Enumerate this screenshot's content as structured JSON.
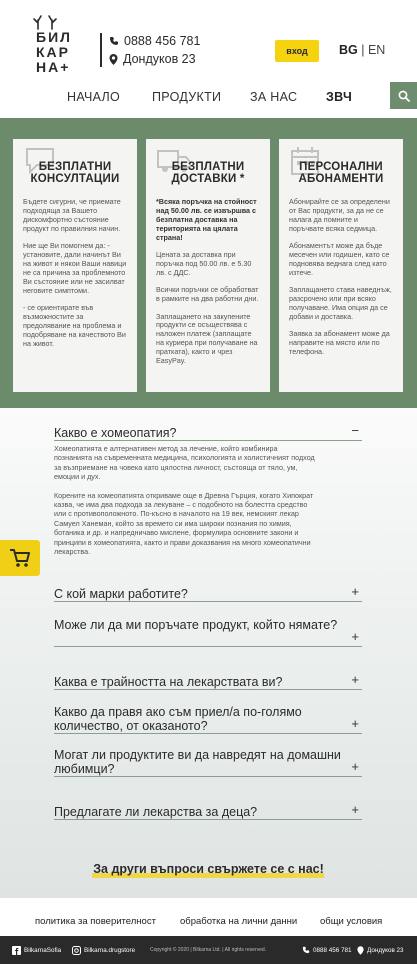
{
  "header": {
    "logo_text": [
      "БИЛ",
      "КАР",
      "НА+"
    ],
    "phone": "0888 456 781",
    "address": "Дондуков 23",
    "login_label": "вход",
    "lang_bg": "BG",
    "lang_sep": "|",
    "lang_en": "EN"
  },
  "nav": {
    "items": [
      "НАЧАЛО",
      "ПРОДУКТИ",
      "ЗА НАС",
      "ЗВЧ"
    ]
  },
  "cards": [
    {
      "icon": "chat-bubble-icon",
      "title_line1": "БЕЗПЛАТНИ",
      "title_line2": "КОНСУЛТАЦИИ",
      "p1": "Бъдете сигурни, че приемате подходяща за Вашето дискомфортно състояние продукт по правилния начин.",
      "p2": "Ние ще Ви помогнем да: - установите, дали начинът Ви на живот и някои Ваши навици не са причина за проблемното Ви състояние или не засилват неговите симптоми.",
      "p3": "- се ориентирате във възможностите за предолявание на проблема и подобряване на качеството Ви на живот."
    },
    {
      "icon": "delivery-truck-icon",
      "title_line1": "БЕЗПЛАТНИ",
      "title_line2": "ДОСТАВКИ *",
      "p1": "*Всяка поръчка на стойност над 50.00 лв. се извършва с безплатна доставка на територията на цялата страна!",
      "p2": "Цената за доставка при поръчка под 50.00 лв. е 5.30 лв. с ДДС.",
      "p3": "Всички поръчки се обработват в рамките на два работни дни.",
      "p4": "Заплащането на закупените продукти се осъществява с наложен платеж (заплащате на куриера при получаване на пратката), както и чрез EasyPay."
    },
    {
      "icon": "calendar-icon",
      "title_line1": "ПЕРСОНАЛНИ",
      "title_line2": "АБОНАМЕНТИ",
      "p1": "Абонирайте се за определени от Вас продукти, за да не се налага да помните и поръчвате всяка седмица.",
      "p2": "Абонаментът може да бъде месечен или годишен, като се подновява веднага след като изтече.",
      "p3": "Заплащането става наведнъж, разсрочено или при всяко получаване. Има опция да се добави и доставка.",
      "p4": "Заявка за абонамент може да направите на място или по телефона."
    }
  ],
  "faq": {
    "items": [
      {
        "q": "Какво е хомеопатия?",
        "toggle": "−"
      },
      {
        "q": "С кой марки работите?",
        "toggle": "+"
      },
      {
        "q": "Може ли да ми поръчате продукт, който нямате?",
        "toggle": "+"
      },
      {
        "q": "Каква е трайността на лекарствата ви?",
        "toggle": "+"
      },
      {
        "q": "Какво да правя ако съм приел/а по-голямо количество, от оказаното?",
        "toggle": "+"
      },
      {
        "q": "Могат ли продуктите ви да навредят на домашни любимци?",
        "toggle": "+"
      },
      {
        "q": "Предлагате ли лекарства за деца?",
        "toggle": "+"
      }
    ],
    "answer_p1": "Хомеопатията е алтернативен метод за лечение, който комбинира познанията на съвременната медицина, психологията и холистичният подход за възприемане на човека като цялостна личност, състояща от тяло, ум, емоции и дух.",
    "answer_p2": "Корените на хомеопатията откриваме още в Древна Гърция, когато Хипократ казва, че има два подхода за лекуване – с подобното на болестта средство или с противоположното. По-късно в началото на 19 век, немският лекар Самуел Ханеман, който за времето си има широки познания по химия, ботаника и др. и напредничаво мислене, формулира основните закони и принципи в хомеопатията, както и прави доказвания на много хомеопатични лекарства."
  },
  "cta": "За други въпроси свържете се с нас!",
  "footer": {
    "links": [
      "политика за поверителност",
      "обработка на лични данни",
      "общи условия"
    ],
    "facebook": "BilkarnaSofia",
    "instagram": "Bilkarna.drugstore",
    "copyright": "Copyright © 2020 | Bilkarna Ltd. | All rights reserved.",
    "phone": "0888 456 781",
    "address": "Дондуков 23"
  },
  "colors": {
    "accent_yellow": "#f5d30f",
    "brand_green": "#6b8b6b",
    "footer_dark": "#2a2a2a"
  }
}
